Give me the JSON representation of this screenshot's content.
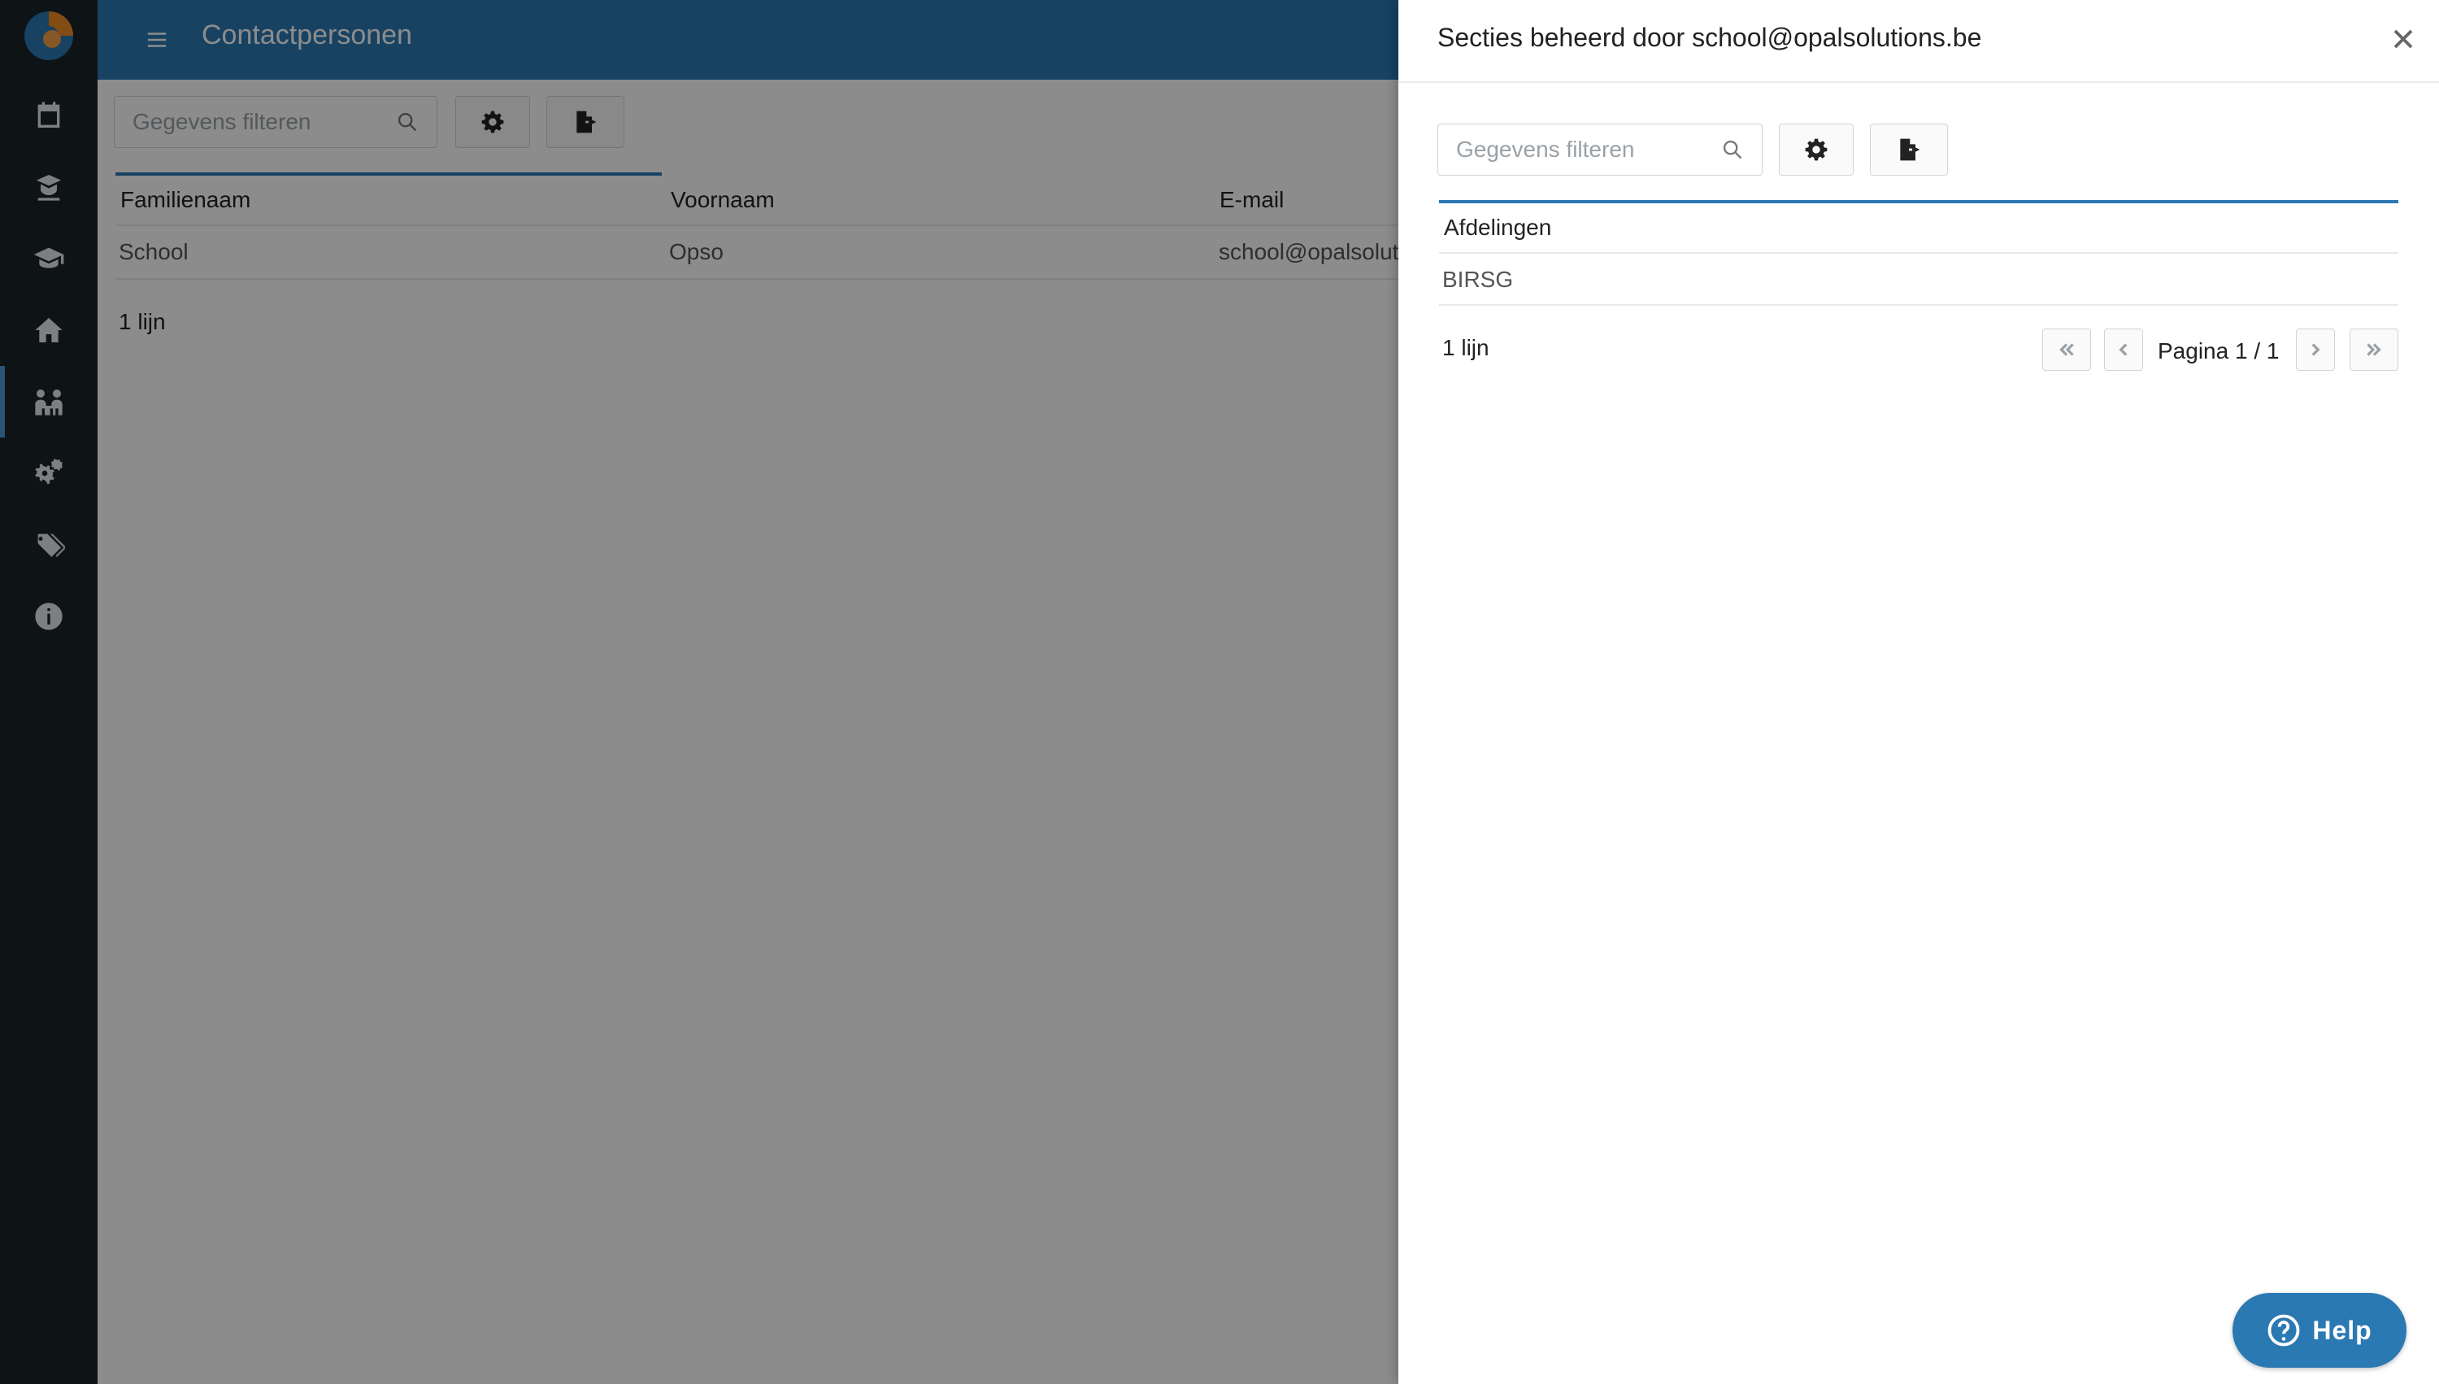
{
  "header": {
    "title": "Contactpersonen",
    "menu_icon": "hamburger-icon"
  },
  "sidebar": {
    "logo": "app-logo",
    "items": [
      {
        "icon": "calendar-icon"
      },
      {
        "icon": "teacher-icon"
      },
      {
        "icon": "graduation-cap-icon"
      },
      {
        "icon": "home-icon"
      },
      {
        "icon": "contacts-icon",
        "active": true
      },
      {
        "icon": "gears-icon"
      },
      {
        "icon": "tags-icon"
      },
      {
        "icon": "info-icon"
      }
    ]
  },
  "main": {
    "filter_placeholder": "Gegevens filteren",
    "columns": [
      "Familienaam",
      "Voornaam",
      "E-mail"
    ],
    "rows": [
      [
        "School",
        "Opso",
        "school@opalsolut"
      ]
    ],
    "row_count": "1 lijn"
  },
  "drawer": {
    "title": "Secties beheerd door school@opalsolutions.be",
    "filter_placeholder": "Gegevens filteren",
    "column": "Afdelingen",
    "rows": [
      "BIRSG"
    ],
    "row_count": "1 lijn",
    "pagination": "Pagina 1 / 1"
  },
  "help": {
    "label": "Help"
  },
  "colors": {
    "accent": "#2b79b3",
    "sidebar_bg": "#1b2429",
    "overlay": "rgba(0,0,0,0.45)"
  }
}
